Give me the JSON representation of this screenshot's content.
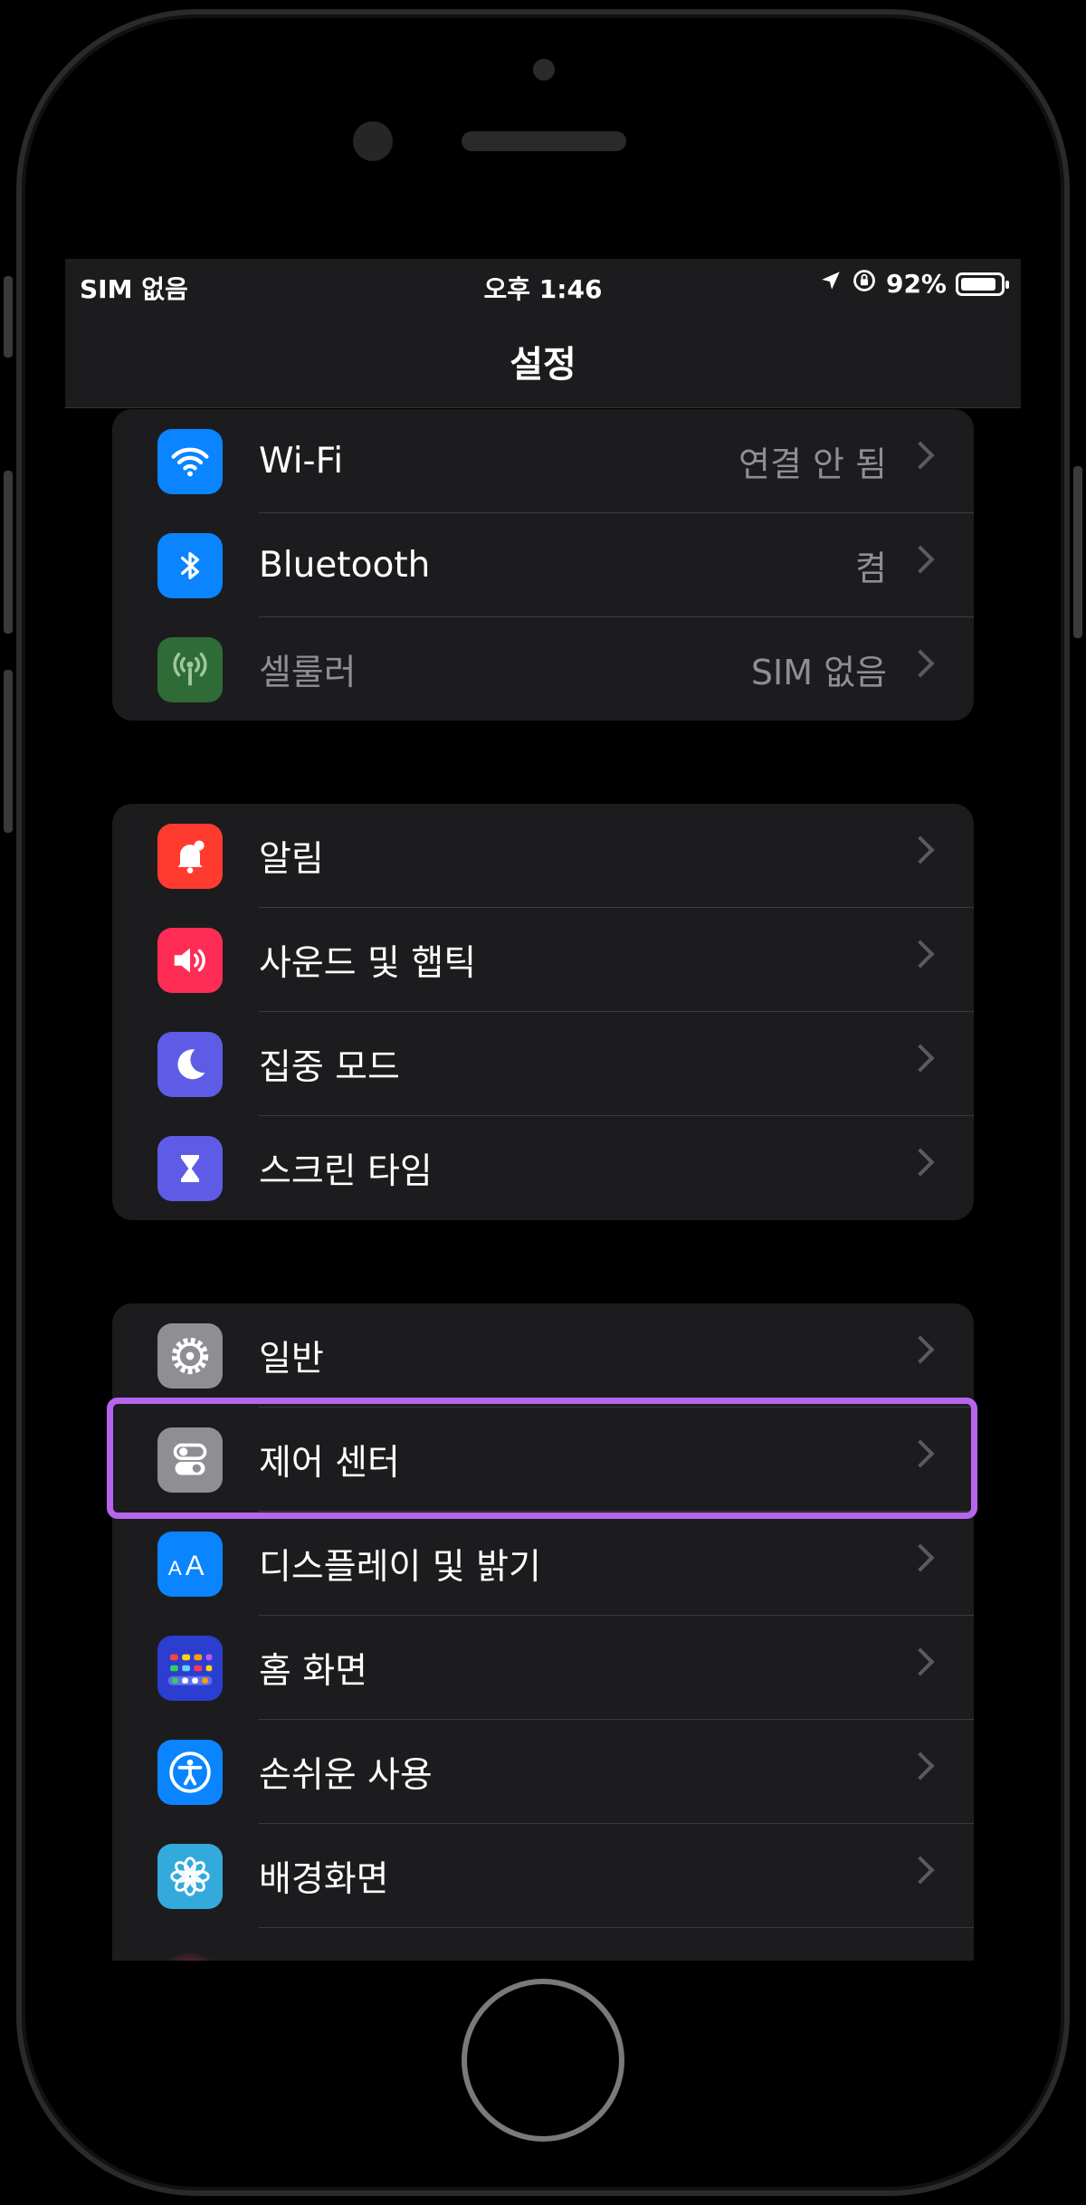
{
  "status_bar": {
    "carrier": "SIM 없음",
    "time": "오후 1:46",
    "battery_percent": "92%",
    "battery_level": 0.92,
    "icons": [
      "location-arrow-icon",
      "orientation-lock-icon",
      "battery-icon"
    ]
  },
  "nav": {
    "title": "설정"
  },
  "groups": [
    {
      "rows": [
        {
          "label": "Wi-Fi",
          "value": "연결 안 됨",
          "icon": "wifi-icon",
          "color": "#0a84ff"
        },
        {
          "label": "Bluetooth",
          "value": "켬",
          "icon": "bluetooth-icon",
          "color": "#0a84ff"
        },
        {
          "label": "셀룰러",
          "value": "SIM 없음",
          "icon": "cellular-icon",
          "color": "#2f6b36",
          "dimmed": true
        }
      ]
    },
    {
      "rows": [
        {
          "label": "알림",
          "icon": "bell-icon",
          "color": "#ff3b30"
        },
        {
          "label": "사운드 및 햅틱",
          "icon": "speaker-icon",
          "color": "#ff2d55"
        },
        {
          "label": "집중 모드",
          "icon": "moon-icon",
          "color": "#5e5ce6"
        },
        {
          "label": "스크린 타임",
          "icon": "hourglass-icon",
          "color": "#5e5ce6"
        }
      ]
    },
    {
      "rows": [
        {
          "label": "일반",
          "icon": "gear-icon",
          "color": "#8e8e93"
        },
        {
          "label": "제어 센터",
          "icon": "toggles-icon",
          "color": "#8e8e93",
          "highlighted": true
        },
        {
          "label": "디스플레이 및 밝기",
          "icon": "text-size-icon",
          "color": "#0a84ff"
        },
        {
          "label": "홈 화면",
          "icon": "app-grid-icon",
          "color": "#2c3ecf"
        },
        {
          "label": "손쉬운 사용",
          "icon": "accessibility-icon",
          "color": "#0a84ff"
        },
        {
          "label": "배경화면",
          "icon": "flower-icon",
          "color": "#34aadc"
        }
      ]
    }
  ],
  "highlight_color": "#b765ee"
}
